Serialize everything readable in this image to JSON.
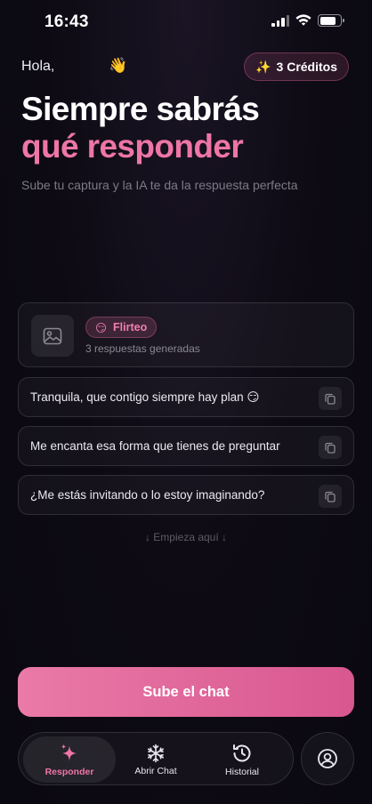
{
  "status_bar": {
    "time": "16:43"
  },
  "header": {
    "greeting": "Hola,",
    "wave_emoji": "👋",
    "credits_icon": "✨",
    "credits_label": "3 Créditos"
  },
  "hero": {
    "title_line1": "Siempre sabrás",
    "title_line2": "qué responder",
    "subtitle": "Sube tu captura y la IA te da la respuesta perfecta"
  },
  "result": {
    "thumbnail_icon": "image-icon",
    "tone_emoji": "😏",
    "tone_label": "Flirteo",
    "count_text": "3 respuestas generadas"
  },
  "replies": [
    {
      "text": "Tranquila, que contigo siempre hay plan 😏"
    },
    {
      "text": "Me encanta esa forma que tienes de preguntar"
    },
    {
      "text": "¿Me estás invitando o lo estoy imaginando?"
    }
  ],
  "hint": "↓ Empieza aquí ↓",
  "cta": {
    "label": "Sube el chat"
  },
  "tabs": [
    {
      "label": "Responder",
      "icon": "sparkles-icon",
      "active": true
    },
    {
      "label": "Abrir Chat",
      "icon": "snowflake-icon",
      "active": false
    },
    {
      "label": "Historial",
      "icon": "history-icon",
      "active": false
    }
  ],
  "profile": {
    "icon": "user-circle-icon"
  },
  "colors": {
    "accent": "#ee76a6",
    "background": "#0d0a13",
    "cta_start": "#ea7aa8",
    "cta_end": "#d8578f"
  }
}
